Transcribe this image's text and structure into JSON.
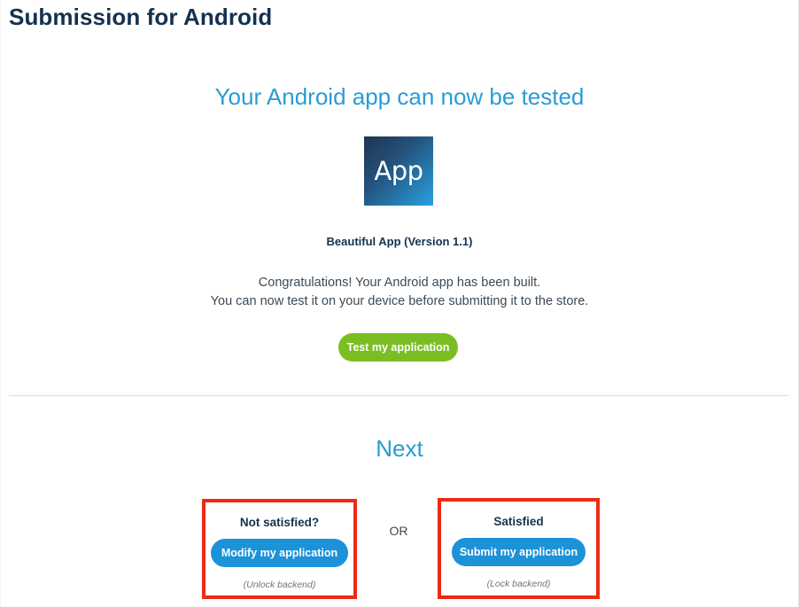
{
  "page": {
    "title": "Submission for Android"
  },
  "hero": {
    "title": "Your Android app can now be tested"
  },
  "app": {
    "icon_label": "App",
    "name": "Beautiful App (Version 1.1)"
  },
  "message": {
    "line1": "Congratulations! Your Android app has been built.",
    "line2": "You can now test it on your device before submitting it to the store."
  },
  "test_button": {
    "label": "Test my application",
    "color": "#7bbe24"
  },
  "next": {
    "title": "Next",
    "or_label": "OR",
    "left": {
      "heading": "Not satisfied?",
      "button_label": "Modify my application",
      "note": "(Unlock backend)"
    },
    "right": {
      "heading": "Satisfied",
      "button_label": "Submit my application",
      "note": "(Lock backend)"
    }
  },
  "colors": {
    "accent_blue": "#2a9bd6",
    "button_blue": "#1c92d9",
    "highlight_red": "#ee2a14",
    "title_navy": "#14324e"
  }
}
